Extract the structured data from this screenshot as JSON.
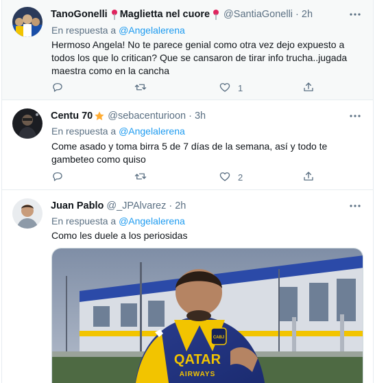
{
  "tweets": [
    {
      "name": "TanoGonelli",
      "name_extra": "Maglietta nel cuore",
      "handle": "@SantiaGonelli",
      "time": "2h",
      "reply_prefix": "En respuesta a",
      "reply_to": "@Angelalerena",
      "text": "Hermoso Angela! No te parece genial como otra vez dejo expuesto a todos los que lo critican? Que se cansaron de tirar info trucha..jugada maestra como en la cancha",
      "reply_count": "",
      "retweet_count": "",
      "like_count": "1"
    },
    {
      "name": "Centu 70",
      "handle": "@sebacenturioon",
      "time": "3h",
      "reply_prefix": "En respuesta a",
      "reply_to": "@Angelalerena",
      "text": "Come asado y toma birra 5 de 7 días de la semana, así y todo te gambeteo como quiso",
      "reply_count": "",
      "retweet_count": "",
      "like_count": "2"
    },
    {
      "name": "Juan Pablo",
      "handle": "@_JPAlvarez",
      "time": "2h",
      "reply_prefix": "En respuesta a",
      "reply_to": "@Angelalerena",
      "text": "Como les duele a los periosidas",
      "media": {
        "jersey_line1": "QATAR",
        "jersey_line2": "AIRWAYS",
        "crest": "CABJ"
      }
    }
  ],
  "separators": {
    "dot": "·"
  },
  "colors": {
    "accent": "#1d9bf0",
    "secondary_text": "#5b7083",
    "border": "#e6ecf0",
    "highlight_bg": "#f7f9f9",
    "pin_red": "#e0245e",
    "star": "#ffac33"
  },
  "icons": [
    "pin-icon",
    "star-icon",
    "more-icon",
    "reply-icon",
    "retweet-icon",
    "like-icon",
    "share-icon"
  ]
}
